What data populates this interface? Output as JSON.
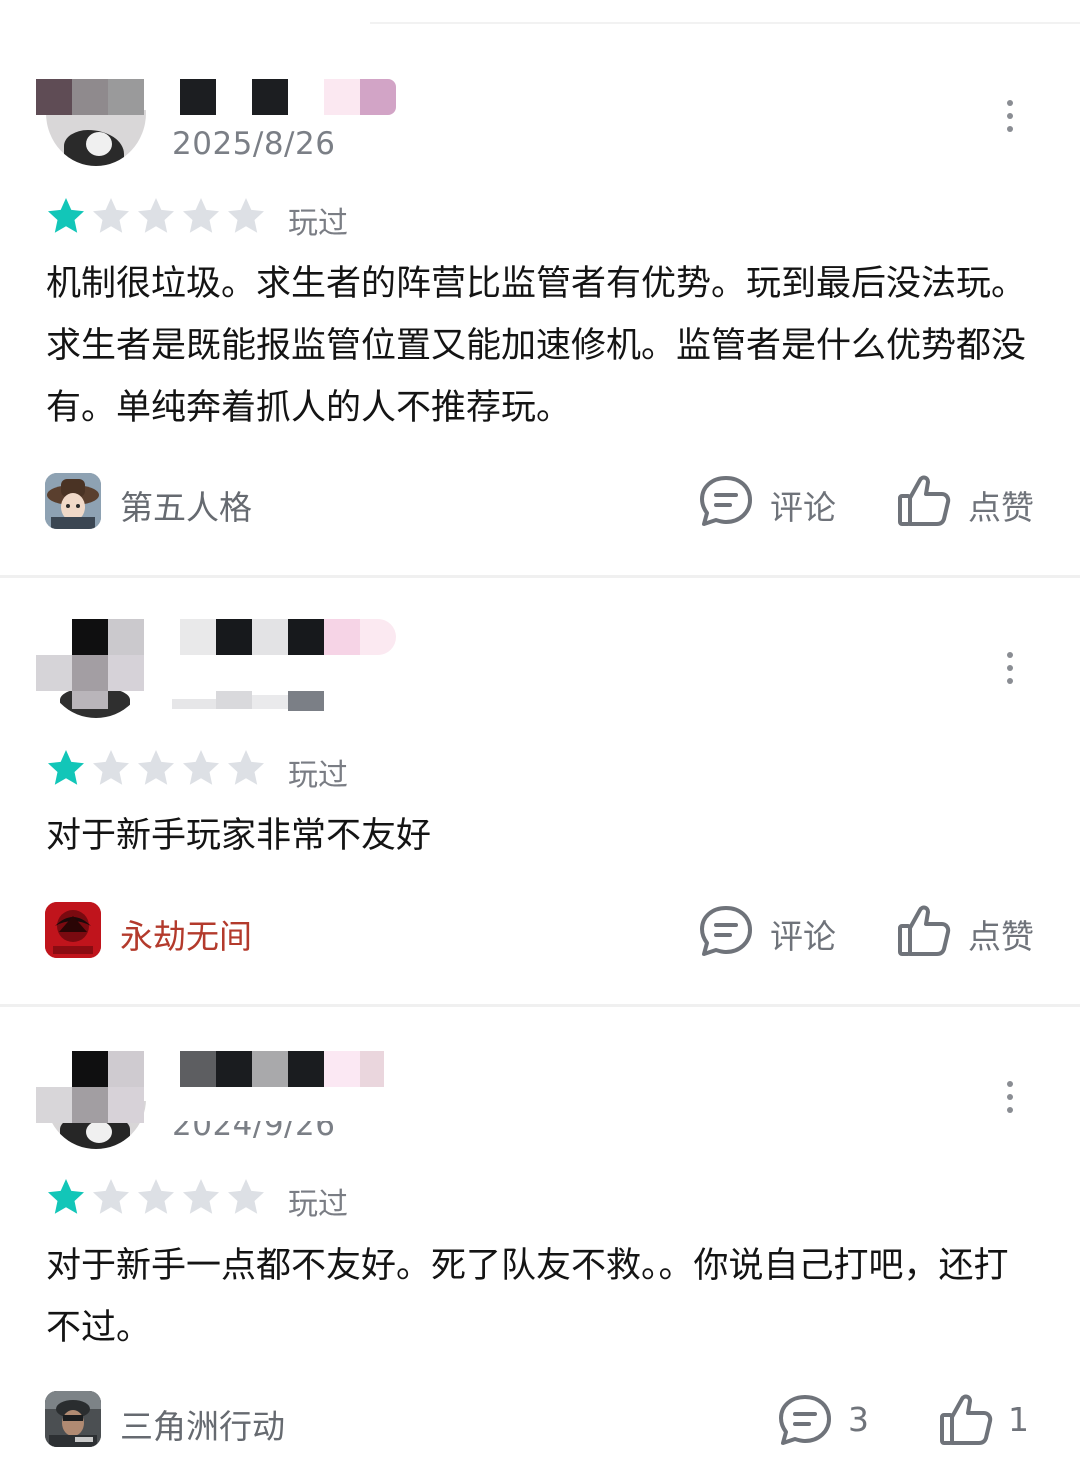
{
  "reviews": [
    {
      "date": "2025/8/26",
      "rating": 1,
      "max_rating": 5,
      "played_label": "玩过",
      "text": "机制很垃圾。求生者的阵营比监管者有优势。玩到最后没法玩。求生者是既能报监管位置又能加速修机。监管者是什么优势都没有。单纯奔着抓人的人不推荐玩。",
      "game": {
        "name": "第五人格",
        "icon": "identity-v-game-icon"
      },
      "comment_label": "评论",
      "like_label": "点赞"
    },
    {
      "date": "",
      "rating": 1,
      "max_rating": 5,
      "played_label": "玩过",
      "text": "对于新手玩家非常不友好",
      "game": {
        "name": "永劫无间",
        "icon": "naraka-game-icon"
      },
      "comment_label": "评论",
      "like_label": "点赞"
    },
    {
      "date": "2024/9/26",
      "rating": 1,
      "max_rating": 5,
      "played_label": "玩过",
      "text": "对于新手一点都不友好。死了队友不救。。你说自己打吧，还打不过。",
      "game": {
        "name": "三角洲行动",
        "icon": "delta-force-game-icon"
      },
      "comment_label": "3",
      "like_label": "1"
    }
  ],
  "colors": {
    "star_filled": "#12c6b8",
    "star_empty": "#dde0e5",
    "muted_text": "#6f737a"
  }
}
